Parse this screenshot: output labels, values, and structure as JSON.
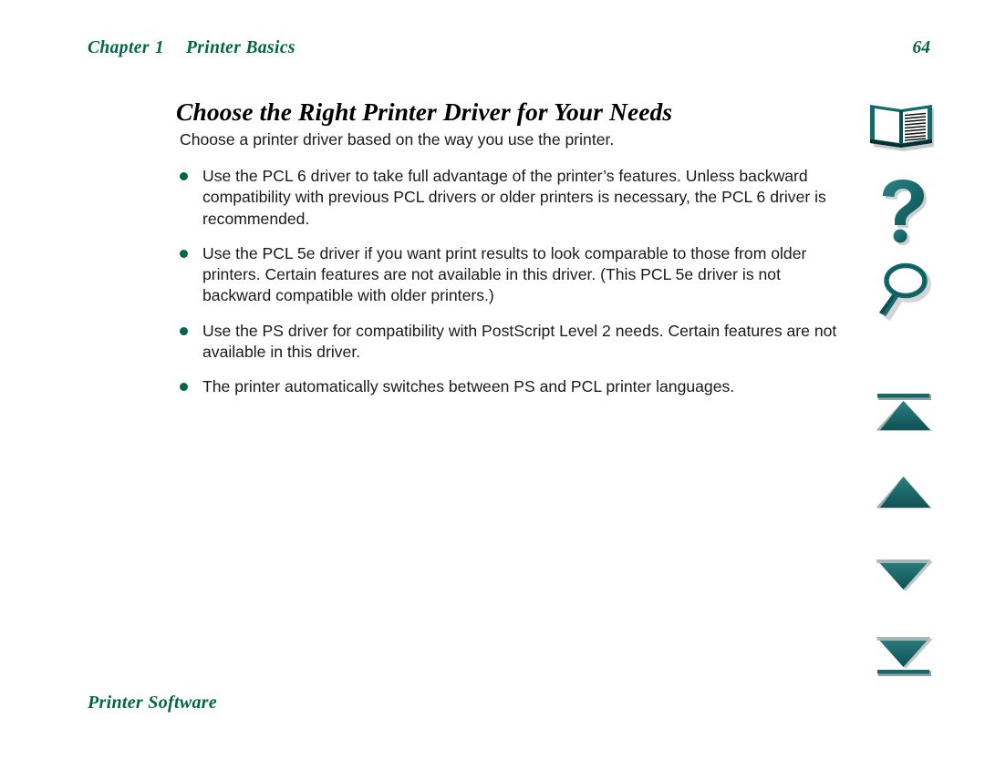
{
  "header": {
    "chapter_word": "Chapter",
    "chapter_number": "1",
    "section_title": "Printer Basics",
    "page_number": "64"
  },
  "title": "Choose the Right Printer Driver for Your Needs",
  "body": {
    "intro": "Choose a printer driver based on the way you use the printer.",
    "bullets": [
      "Use the PCL 6 driver to take full advantage of the printer’s features. Unless backward compatibility with previous PCL drivers or older printers is necessary, the PCL 6 driver is recommended.",
      "Use the PCL 5e driver if you want print results to look comparable to those from older printers. Certain features are not available in this driver. (This PCL 5e driver is not backward compatible with older printers.)",
      "Use the PS driver for compatibility with PostScript Level 2 needs. Certain features are not available in this driver.",
      "The printer automatically switches between PS and PCL printer languages."
    ]
  },
  "footer": {
    "label": "Printer Software"
  },
  "rail": {
    "icons": [
      {
        "name": "book-icon",
        "label": "Table of Contents"
      },
      {
        "name": "question-mark-icon",
        "label": "Help"
      },
      {
        "name": "magnifier-icon",
        "label": "Search"
      },
      {
        "name": "first-page-icon",
        "label": "First Page"
      },
      {
        "name": "previous-page-icon",
        "label": "Previous Page"
      },
      {
        "name": "next-page-icon",
        "label": "Next Page"
      },
      {
        "name": "last-page-icon",
        "label": "Last Page"
      }
    ]
  },
  "colors": {
    "heading_green": "#006647",
    "icon_teal": "#1a6b6b",
    "icon_teal_dark": "#0d4f4f",
    "bullet_green": "#006647",
    "body_text": "#1a1a1a",
    "page_background": "#ffffff"
  }
}
